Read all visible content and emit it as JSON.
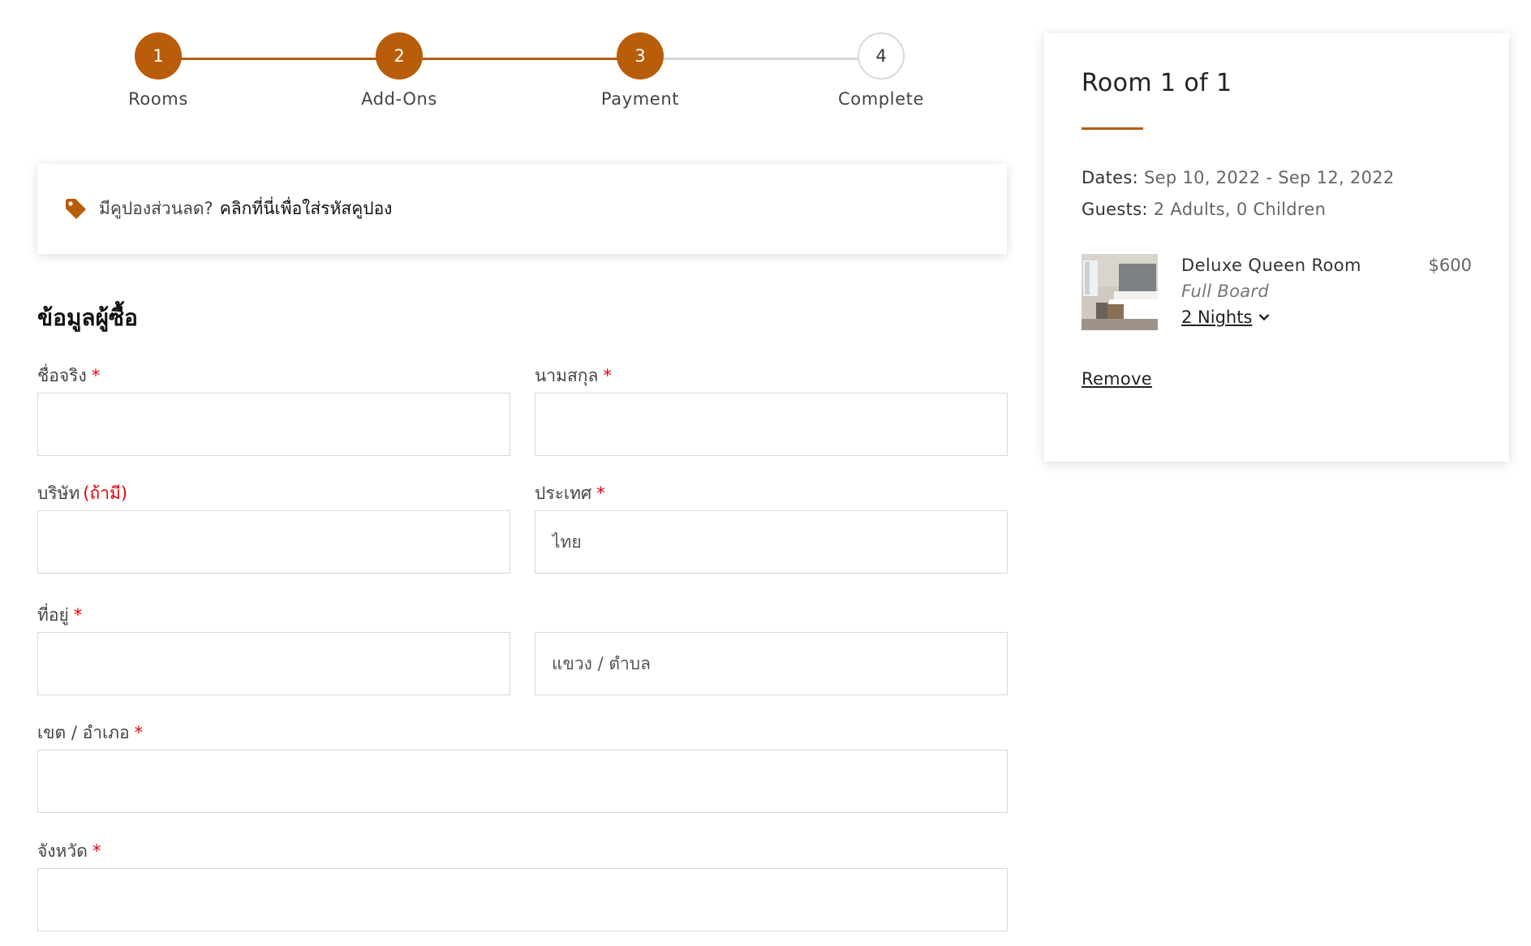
{
  "steps": [
    {
      "number": "1",
      "label": "Rooms",
      "state": "done"
    },
    {
      "number": "2",
      "label": "Add-Ons",
      "state": "done"
    },
    {
      "number": "3",
      "label": "Payment",
      "state": "current"
    },
    {
      "number": "4",
      "label": "Complete",
      "state": "todo"
    }
  ],
  "colors": {
    "accent": "#b95d0a",
    "required": "#e0000a",
    "inactive_line": "#d8d8d8"
  },
  "coupon": {
    "icon": "tag-icon",
    "text": "มีคูปองส่วนลด?",
    "link": "คลิกที่นี่เพื่อใส่รหัสคูปอง"
  },
  "form": {
    "title": "ข้อมูลผู้ซื้อ",
    "required_mark": "*",
    "first_name": {
      "label": "ชื่อจริง",
      "value": ""
    },
    "last_name": {
      "label": "นามสกุล",
      "value": ""
    },
    "company": {
      "label": "บริษัท",
      "optional": "(ถ้ามี)",
      "value": ""
    },
    "country": {
      "label": "ประเทศ",
      "value": "ไทย"
    },
    "address": {
      "label": "ที่อยู่",
      "value": ""
    },
    "subdistrict": {
      "placeholder": "แขวง / ตำบล",
      "value": ""
    },
    "district": {
      "label": "เขต / อำเภอ",
      "value": ""
    },
    "province": {
      "label": "จังหวัด",
      "value": ""
    }
  },
  "summary": {
    "title": "Room 1 of 1",
    "dates_label": "Dates:",
    "dates_value": "Sep 10, 2022 - Sep 12, 2022",
    "guests_label": "Guests:",
    "guests_value": "2 Adults, 0 Children",
    "room": {
      "name": "Deluxe Queen Room",
      "board": "Full Board",
      "nights": "2 Nights",
      "price": "$600",
      "image": "room-photo"
    },
    "remove": "Remove"
  }
}
